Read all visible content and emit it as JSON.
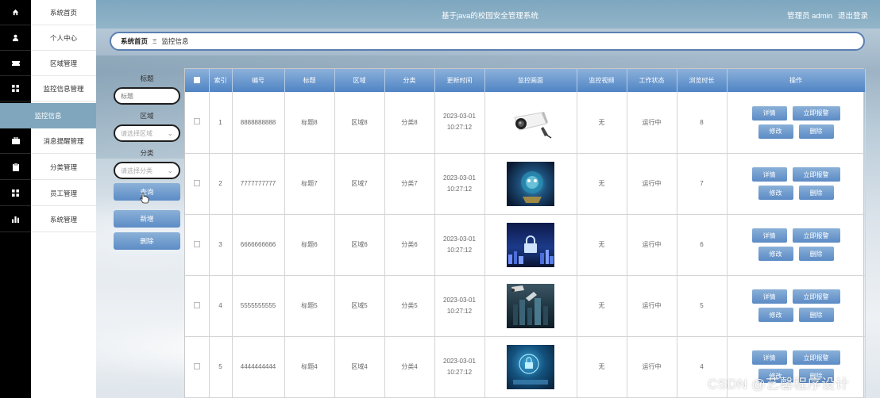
{
  "app": {
    "title": "基于java的校园安全管理系统",
    "user": "管理员 admin",
    "logout": "退出登录"
  },
  "sidebar": {
    "items": [
      {
        "label": "系统首页",
        "icon": "home-icon"
      },
      {
        "label": "个人中心",
        "icon": "user-icon"
      },
      {
        "label": "区域管理",
        "icon": "ticket-icon"
      },
      {
        "label": "监控信息管理",
        "icon": "grid-icon"
      },
      {
        "label": "监控信息",
        "icon": "",
        "active": true
      },
      {
        "label": "消息提醒管理",
        "icon": "briefcase-icon"
      },
      {
        "label": "分类管理",
        "icon": "clipboard-icon"
      },
      {
        "label": "员工管理",
        "icon": "grid-icon"
      },
      {
        "label": "系统管理",
        "icon": "bar-chart-icon"
      }
    ]
  },
  "breadcrumb": {
    "home": "系统首页",
    "separator": "Ξ",
    "current": "监控信息"
  },
  "search": {
    "title_label": "标题",
    "title_placeholder": "标题",
    "area_label": "区域",
    "area_placeholder": "请选择区域",
    "category_label": "分类",
    "category_placeholder": "请选择分类",
    "query_button": "查询",
    "add_button": "新增",
    "delete_button": "删除"
  },
  "table": {
    "headers": [
      "索引",
      "编号",
      "标题",
      "区域",
      "分类",
      "更新时间",
      "监控画面",
      "监控视频",
      "工作状态",
      "浏览时长",
      "操作"
    ],
    "actions": {
      "detail": "详情",
      "alarm": "立即报警",
      "edit": "修改",
      "delete": "删除"
    },
    "rows": [
      {
        "index": "1",
        "code": "8888888888",
        "title": "标题8",
        "area": "区域8",
        "category": "分类8",
        "date": "2023-03-01",
        "time": "10:27:12",
        "image": "security-camera",
        "video": "无",
        "status": "运行中",
        "duration": "8"
      },
      {
        "index": "2",
        "code": "7777777777",
        "title": "标题7",
        "area": "区域7",
        "category": "分类7",
        "date": "2023-03-01",
        "time": "10:27:12",
        "image": "cyber-robot",
        "video": "无",
        "status": "运行中",
        "duration": "7"
      },
      {
        "index": "3",
        "code": "6666666666",
        "title": "标题6",
        "area": "区域6",
        "category": "分类6",
        "date": "2023-03-01",
        "time": "10:27:12",
        "image": "city-lock",
        "video": "无",
        "status": "运行中",
        "duration": "6"
      },
      {
        "index": "4",
        "code": "5555555555",
        "title": "标题5",
        "area": "区域5",
        "category": "分类5",
        "date": "2023-03-01",
        "time": "10:27:12",
        "image": "city-cameras",
        "video": "无",
        "status": "运行中",
        "duration": "5"
      },
      {
        "index": "5",
        "code": "4444444444",
        "title": "标题4",
        "area": "区域4",
        "category": "分类4",
        "date": "2023-03-01",
        "time": "10:27:12",
        "image": "digital-lock",
        "video": "无",
        "status": "运行中",
        "duration": "4"
      }
    ]
  },
  "watermark": "CSDN @艺馨程序设计",
  "colors": {
    "accent": "#5b8bc5",
    "topbar": "#86acc3",
    "active_menu": "#7fa6bc"
  }
}
